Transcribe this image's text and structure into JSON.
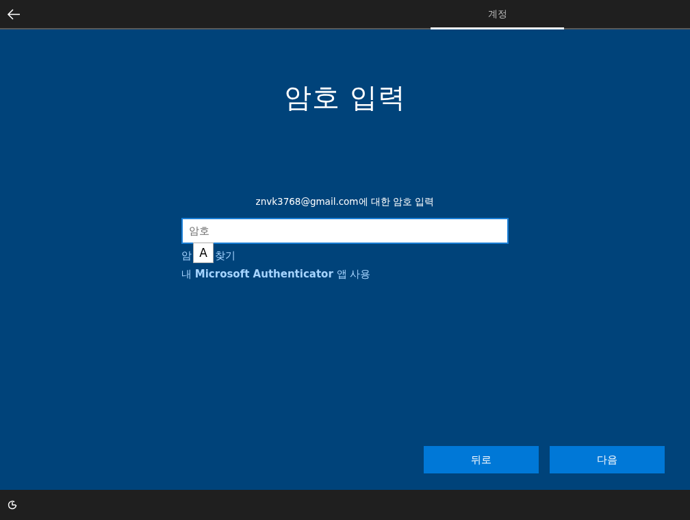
{
  "top_bar": {
    "tabs": [
      {
        "label": "계정",
        "selected": true
      }
    ]
  },
  "title": "암호 입력",
  "prompt": "znvk3768@gmail.com에 대한 암호 입력",
  "password_field": {
    "placeholder": "암호",
    "focused": true
  },
  "ime_indicator": "A",
  "forgot_link_parts": [
    "암",
    "찾기"
  ],
  "authenticator_link": "내 **Microsoft Authenticator** 앱 사용",
  "buttons": [
    {
      "label": "뒤로"
    },
    {
      "label": "다음"
    }
  ]
}
